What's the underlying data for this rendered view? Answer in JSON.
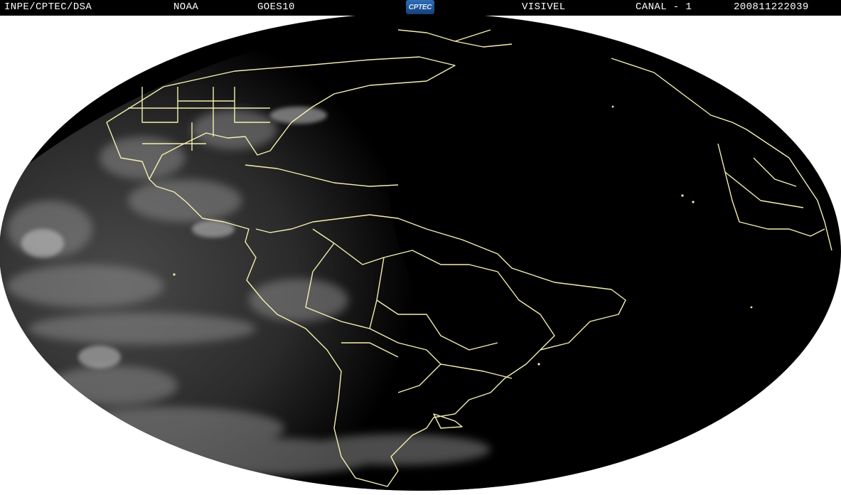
{
  "header": {
    "institution": "INPE/CPTEC/DSA",
    "agency": "NOAA",
    "satellite": "GOES10",
    "logo_text": "CPTEC",
    "band": "VISIVEL",
    "channel": "CANAL - 1",
    "timestamp": "200811222039"
  },
  "colors": {
    "background": "#ffffff",
    "header_bg": "#000000",
    "header_text": "#ffffff",
    "globe_night": "#000000",
    "cloud_day": "#5a5a5a",
    "boundary_lines": "#f3efb0",
    "logo_blue": "#2f6db5"
  },
  "map": {
    "projection": "full-disk visible satellite image",
    "boundaries": "continental and national borders",
    "illumination": "western half daylit, eastern half night"
  }
}
